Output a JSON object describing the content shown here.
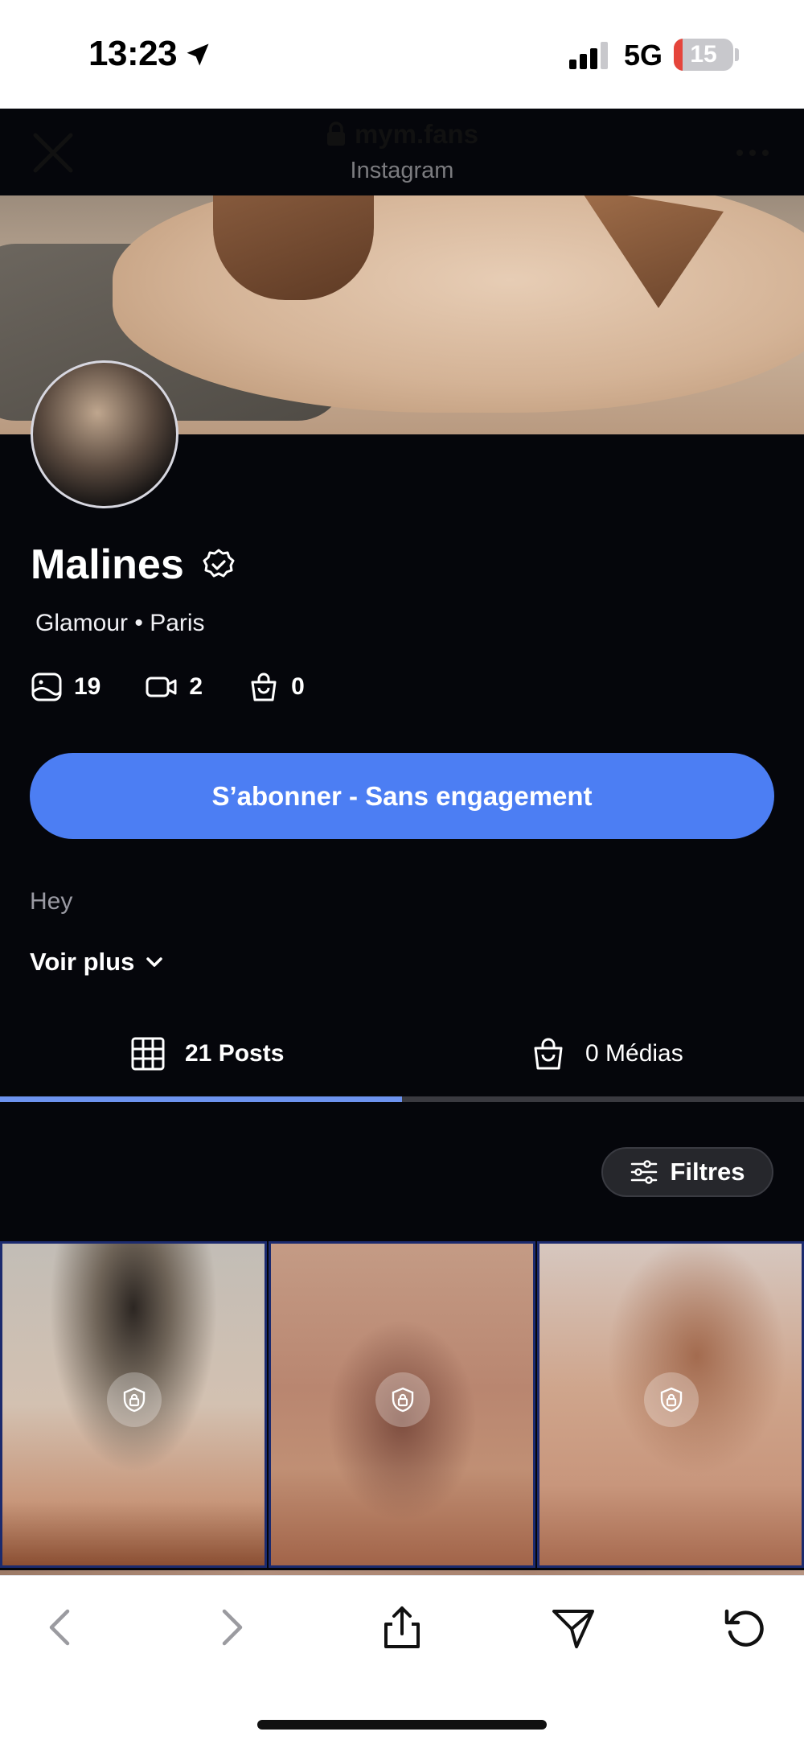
{
  "status_bar": {
    "time": "13:23",
    "network": "5G",
    "battery": "15",
    "battery_level": 0.15
  },
  "browser": {
    "url": "mym.fans",
    "source": "Instagram"
  },
  "profile": {
    "name": "Malines",
    "tagline": "Glamour • Paris",
    "stats": {
      "photos": "19",
      "videos": "2",
      "purchases": "0"
    },
    "subscribe_label": "S’abonner - Sans engagement",
    "bio": "Hey",
    "see_more_label": "Voir plus"
  },
  "tabs": [
    {
      "label": "21 Posts",
      "active": true
    },
    {
      "label": "0 Médias",
      "active": false
    }
  ],
  "filters_label": "Filtres",
  "colors": {
    "accent": "#4c7ef3",
    "background": "#05060b",
    "tab_indicator": "#6d93ef"
  },
  "icons": [
    "location-arrow-icon",
    "signal-icon",
    "lock-icon",
    "close-icon",
    "more-icon",
    "verified-icon",
    "photo-icon",
    "video-icon",
    "bag-icon",
    "chevron-down-icon",
    "grid-icon",
    "filter-icon",
    "back-icon",
    "forward-icon",
    "share-icon",
    "send-icon",
    "reload-icon"
  ]
}
